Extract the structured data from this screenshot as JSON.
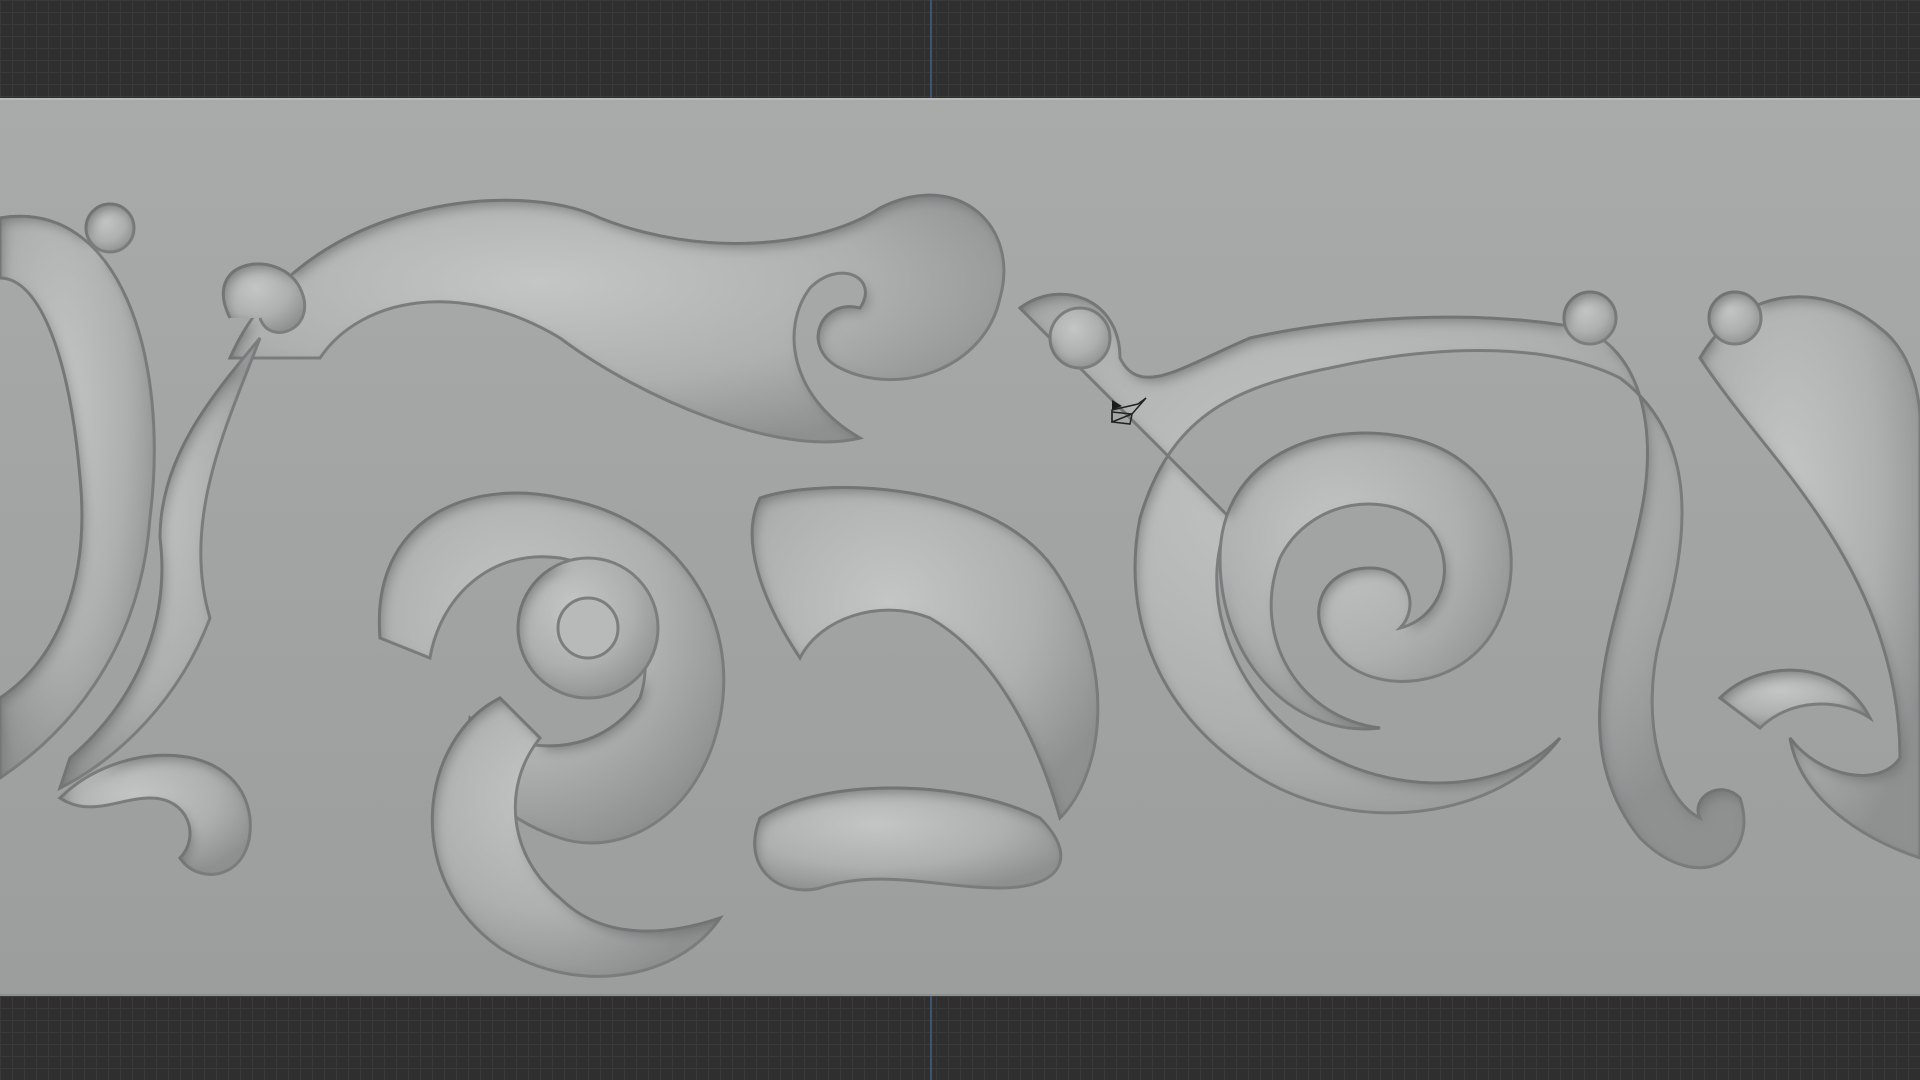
{
  "viewport": {
    "background": "#2f2f2f",
    "grid_color": "#3a3a3a",
    "axis_color": "#3d5570"
  },
  "model": {
    "name": "ornamental-scroll-relief",
    "color": "#a6a8a8"
  },
  "gizmo": {
    "icon": "camera-icon"
  }
}
